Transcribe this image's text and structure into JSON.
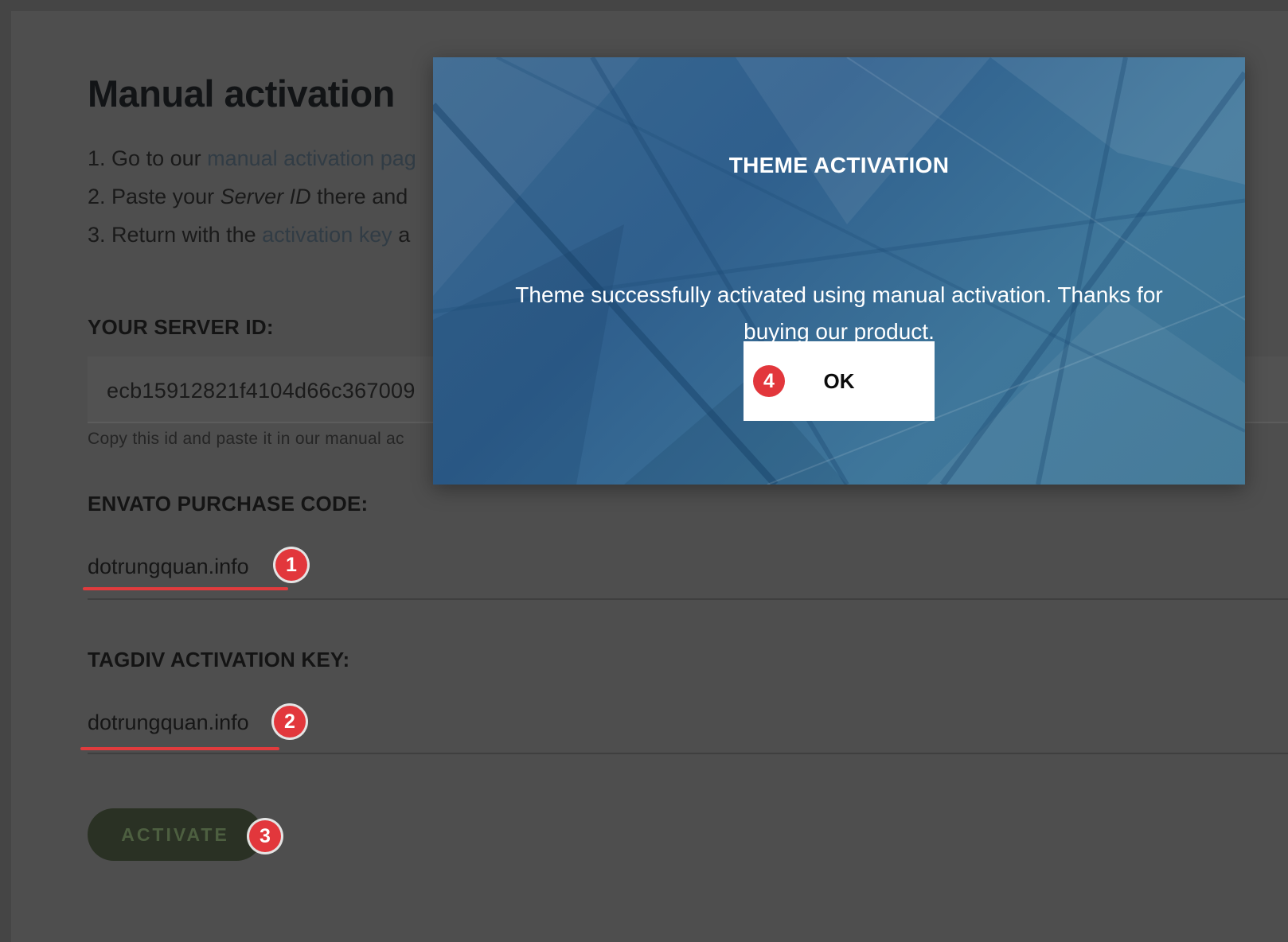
{
  "page": {
    "title": "Manual activation",
    "steps": [
      {
        "number": "1.",
        "text_before": "Go to our ",
        "link": "manual activation pag"
      },
      {
        "number": "2.",
        "text_before": "Paste your ",
        "emphasis": "Server ID",
        "text_after": " there and"
      },
      {
        "number": "3.",
        "text_before": "Return with the ",
        "link": "activation key",
        "text_after": " a"
      }
    ]
  },
  "server_id": {
    "label": "YOUR SERVER ID:",
    "value": "ecb15912821f4104d66c367009",
    "help": "Copy this id and paste it in our manual ac"
  },
  "envato": {
    "label": "ENVATO PURCHASE CODE:",
    "value": "dotrungquan.info"
  },
  "tagdiv": {
    "label": "TAGDIV ACTIVATION KEY:",
    "value": "dotrungquan.info"
  },
  "activate_button": {
    "label": "ACTIVATE"
  },
  "annotations": {
    "badge_1": "1",
    "badge_2": "2",
    "badge_3": "3",
    "badge_4": "4"
  },
  "modal": {
    "title": "THEME ACTIVATION",
    "message": "Theme successfully activated using manual activation. Thanks for buying our product.",
    "ok_label": "OK"
  },
  "colors": {
    "page_background": "#4e4e4e",
    "modal_blue": "#2f5f8d",
    "annotation_red": "#e2373c",
    "activate_green": "#2a3124"
  }
}
